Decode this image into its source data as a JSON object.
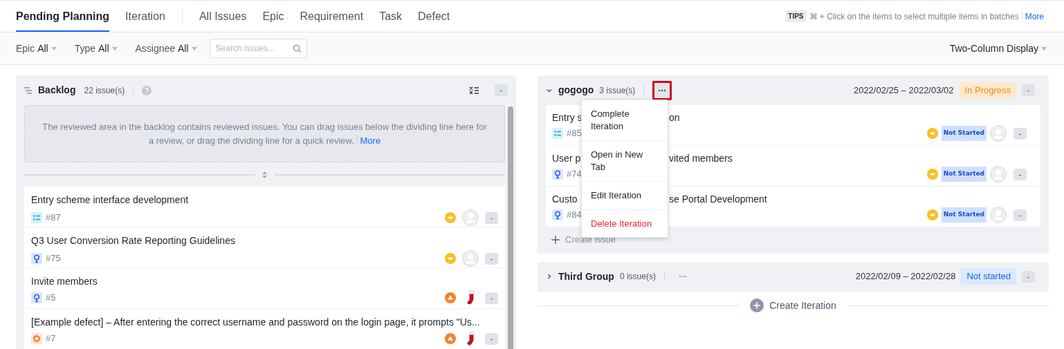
{
  "tabs": [
    {
      "label": "Pending Planning",
      "selected": true,
      "divider_before": false
    },
    {
      "label": "Iteration",
      "selected": false,
      "divider_before": false
    },
    {
      "label": "All Issues",
      "selected": false,
      "divider_before": true
    },
    {
      "label": "Epic",
      "selected": false,
      "divider_before": false
    },
    {
      "label": "Requirement",
      "selected": false,
      "divider_before": false
    },
    {
      "label": "Task",
      "selected": false,
      "divider_before": false
    },
    {
      "label": "Defect",
      "selected": false,
      "divider_before": false
    }
  ],
  "tips": {
    "badge": "TIPS",
    "text": "⌘ + Click on the items to select multiple items in batches",
    "link": "More"
  },
  "filters": [
    {
      "label": "Epic",
      "value": "All"
    },
    {
      "label": "Type",
      "value": "All"
    },
    {
      "label": "Assignee",
      "value": "All"
    }
  ],
  "search": {
    "placeholder": "Search issues..."
  },
  "display": "Two-Column Display",
  "backlog": {
    "title": "Backlog",
    "count": "22 issue(s)",
    "notice": "The reviewed area in the backlog contains reviewed issues. You can drag issues below the dividing line here for a review, or drag the dividing line for a quick review.",
    "notice_link": "More",
    "issues": [
      {
        "title": "Entry scheme interface development",
        "kind": "task",
        "number": "#87",
        "priority": {
          "kind": "medium"
        },
        "assignee": {
          "kind": "none"
        },
        "action": "-"
      },
      {
        "title": "Q3 User Conversion Rate Reporting Guidelines",
        "kind": "requirement",
        "number": "#75",
        "priority": {
          "kind": "medium"
        },
        "assignee": {
          "kind": "none"
        },
        "action": "-"
      },
      {
        "title": "Invite members",
        "kind": "requirement",
        "number": "#5",
        "priority": {
          "kind": "high"
        },
        "assignee": {
          "kind": "avatar"
        },
        "action": "-"
      },
      {
        "title": "[Example defect] – After entering the correct username and password on the login page, it prompts \"Us...",
        "kind": "defect",
        "number": "#7",
        "priority": {
          "kind": "high"
        },
        "assignee": {
          "kind": "avatar"
        },
        "action": "-"
      }
    ],
    "action": "-"
  },
  "iterations": [
    {
      "name": "gogogo",
      "count": "3 issue(s)",
      "expanded": true,
      "dates": "2022/02/25 – 2022/03/02",
      "status": {
        "text": "In Progress",
        "kind": "in_progress"
      },
      "action": "-",
      "menu_open": true,
      "menu": [
        {
          "label": "Complete Iteration",
          "danger": false
        },
        {
          "label": "Open in New Tab",
          "danger": false
        },
        {
          "label": "Edit Iteration",
          "danger": false
        },
        {
          "label": "Delete Iteration",
          "danger": true
        }
      ],
      "issues": [
        {
          "title_start": "Entry s",
          "title_end": "on",
          "kind": "task",
          "number": "#85",
          "priority": {
            "kind": "medium"
          },
          "status": "Not Started",
          "assignee": {
            "kind": "none"
          },
          "action": "-"
        },
        {
          "title_start": "User p",
          "title_end": "vited members",
          "kind": "requirement",
          "number": "#74",
          "priority": {
            "kind": "medium"
          },
          "status": "Not Started",
          "assignee": {
            "kind": "none"
          },
          "action": "-"
        },
        {
          "title_start": "Custo",
          "title_end": "se Portal Development",
          "kind": "requirement",
          "number": "#84",
          "priority": {
            "kind": "medium"
          },
          "status": "Not Started",
          "assignee": {
            "kind": "none"
          },
          "action": "-"
        }
      ],
      "create_issue": "Create issue"
    },
    {
      "name": "Third Group",
      "count": "0 issue(s)",
      "expanded": false,
      "dates": "2022/02/09 – 2022/02/28",
      "status": {
        "text": "Not started",
        "kind": "not_started"
      },
      "action": "-",
      "menu_open": false
    }
  ],
  "create_iteration": "Create Iteration"
}
